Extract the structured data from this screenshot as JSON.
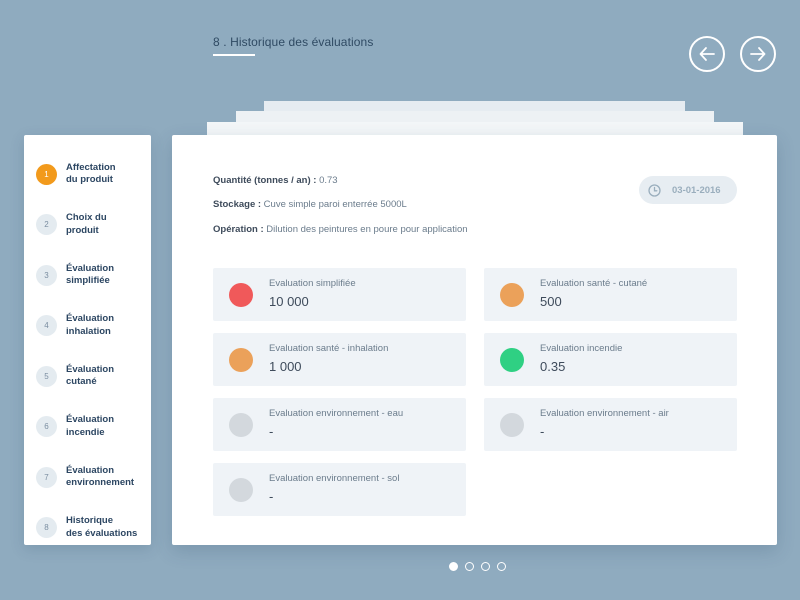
{
  "header": {
    "title": "8 . Historique des évaluations"
  },
  "nav": {
    "prev_icon": "arrow-left-icon",
    "next_icon": "arrow-right-icon"
  },
  "steps": [
    {
      "num": "1",
      "label": "Affectation\ndu produit",
      "active": true
    },
    {
      "num": "2",
      "label": "Choix du\nproduit",
      "active": false
    },
    {
      "num": "3",
      "label": "Évaluation\nsimplifiée",
      "active": false
    },
    {
      "num": "4",
      "label": "Évaluation\ninhalation",
      "active": false
    },
    {
      "num": "5",
      "label": "Évaluation\ncutané",
      "active": false
    },
    {
      "num": "6",
      "label": "Évaluation\nincendie",
      "active": false
    },
    {
      "num": "7",
      "label": "Évaluation\nenvironnement",
      "active": false
    },
    {
      "num": "8",
      "label": "Historique\ndes évaluations",
      "active": false
    }
  ],
  "details": {
    "quantity_label": "Quantité (tonnes / an) :",
    "quantity_value": " 0.73",
    "storage_label": "Stockage :",
    "storage_value": " Cuve simple paroi enterrée 5000L",
    "operation_label": "Opération :",
    "operation_value": " Dilution des peintures en poure pour application",
    "date": "03-01-2016"
  },
  "tiles": [
    {
      "label": "Evaluation simplifiée",
      "value": "10 000",
      "color": "#f0595a"
    },
    {
      "label": "Evaluation santé - cutané",
      "value": "500",
      "color": "#eba15a"
    },
    {
      "label": "Evaluation santé - inhalation",
      "value": "1 000",
      "color": "#eba15a"
    },
    {
      "label": "Evaluation incendie",
      "value": "0.35",
      "color": "#2fd083"
    },
    {
      "label": "Evaluation environnement - eau",
      "value": "-",
      "color": "#d3d8dd"
    },
    {
      "label": "Evaluation environnement - air",
      "value": "-",
      "color": "#d3d8dd"
    },
    {
      "label": "Evaluation environnement - sol",
      "value": "-",
      "color": "#d3d8dd"
    }
  ],
  "pager": {
    "count": 4,
    "active": 0
  },
  "colors": {
    "background": "#8fabbf",
    "accent": "#f29a1c"
  }
}
